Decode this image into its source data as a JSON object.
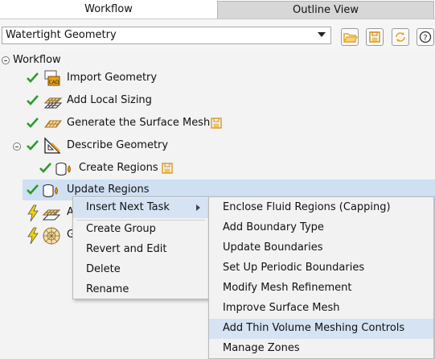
{
  "tabs": [
    {
      "label": "Workflow"
    },
    {
      "label": "Outline View"
    }
  ],
  "toolbar": {
    "workflow_type": "Watertight Geometry"
  },
  "tree": {
    "root_label": "Workflow",
    "items": [
      {
        "label": "Import Geometry",
        "status": "done",
        "icon": "cad-import-icon"
      },
      {
        "label": "Add Local Sizing",
        "status": "done",
        "icon": "mesh-sizing-icon"
      },
      {
        "label": "Generate the Surface Mesh",
        "status": "done",
        "icon": "surface-mesh-icon",
        "saved": true
      },
      {
        "label": "Describe Geometry",
        "status": "done",
        "icon": "describe-geometry-icon"
      },
      {
        "label": "Create Regions",
        "status": "done",
        "icon": "create-regions-icon",
        "saved": true
      },
      {
        "label": "Update Regions",
        "status": "done",
        "icon": "update-regions-icon",
        "selected": true
      },
      {
        "label": "A",
        "status": "pending",
        "icon": "mesh-sizing-icon"
      },
      {
        "label": "G",
        "status": "pending",
        "icon": "volume-mesh-icon"
      }
    ]
  },
  "context_menu": {
    "items": [
      "Insert Next Task",
      "Create Group",
      "Revert and Edit",
      "Delete",
      "Rename"
    ]
  },
  "submenu": {
    "items": [
      "Enclose Fluid Regions (Capping)",
      "Add Boundary Type",
      "Update Boundaries",
      "Set Up Periodic Boundaries",
      "Modify Mesh Refinement",
      "Improve Surface Mesh",
      "Add Thin Volume Meshing Controls",
      "Manage Zones"
    ],
    "highlighted": "Add Thin Volume Meshing Controls"
  },
  "colors": {
    "check": "#2e9a2e",
    "lightning": "#f2d400",
    "selection": "#cfe0f3",
    "menu_highlight": "#d5e3f3",
    "toolbar_icon": "#e8a21c"
  }
}
